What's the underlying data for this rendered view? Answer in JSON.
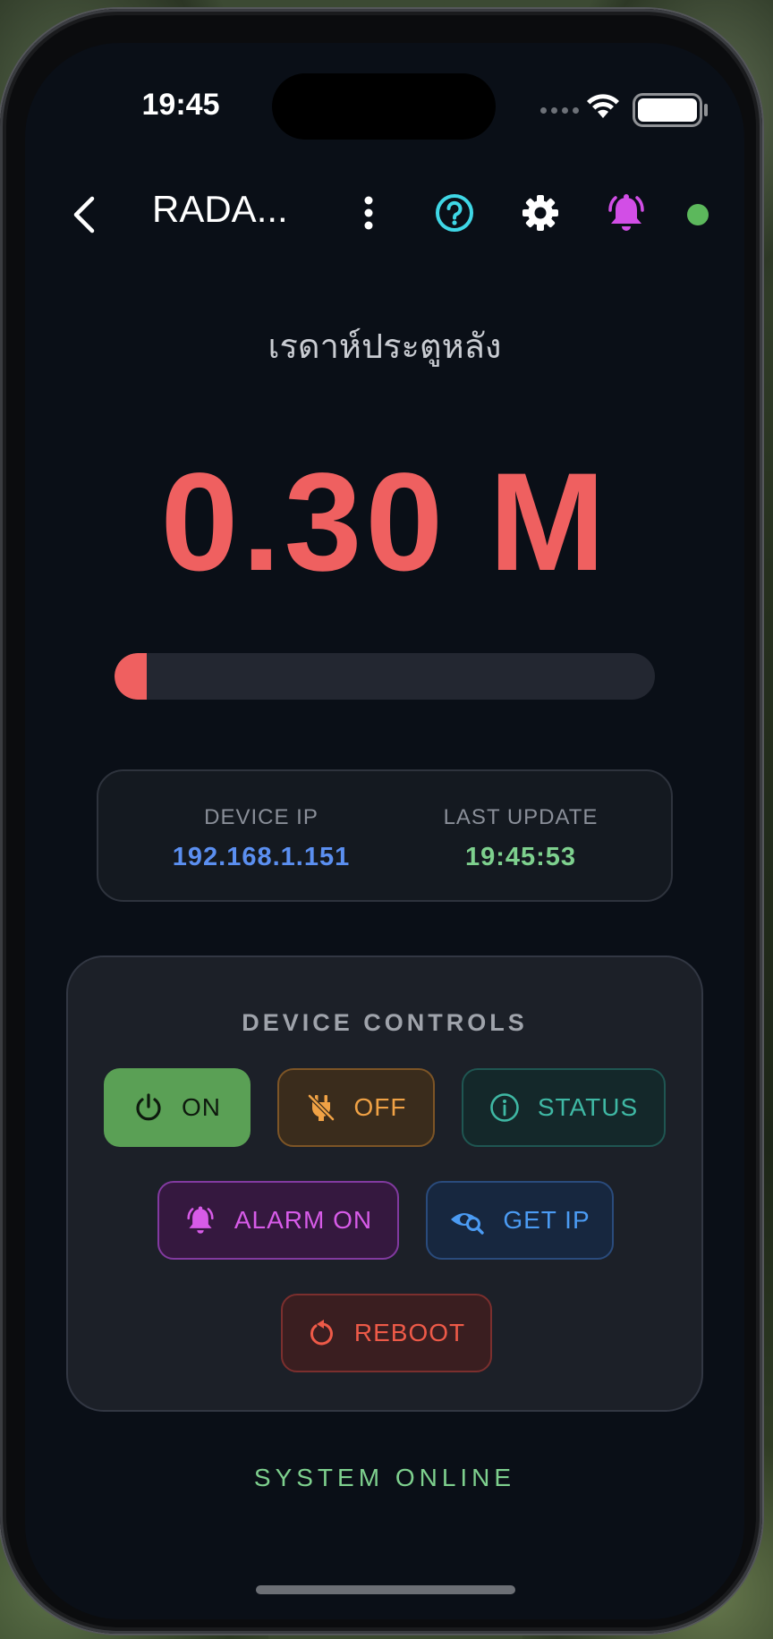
{
  "status_bar": {
    "time": "19:45"
  },
  "header": {
    "title": "RADA...",
    "icons": [
      "chevron-left-icon",
      "more-vertical-icon",
      "help-icon",
      "gear-icon",
      "bell-alert-icon"
    ],
    "connection_status_color": "#5cb85c"
  },
  "device": {
    "name": "เรดาห์ประตูหลัง",
    "distance": "0.30 M",
    "distance_progress": 0.06
  },
  "info": {
    "ip_label": "DEVICE IP",
    "ip_value": "192.168.1.151",
    "update_label": "LAST UPDATE",
    "update_value": "19:45:53"
  },
  "controls": {
    "title": "DEVICE CONTROLS",
    "buttons": [
      {
        "label": "ON",
        "icon": "power-icon",
        "color": "#ffffff"
      },
      {
        "label": "OFF",
        "icon": "plug-off-icon",
        "color": "#f0a245"
      },
      {
        "label": "STATUS",
        "icon": "info-icon",
        "color": "#3fb8a4"
      },
      {
        "label": "ALARM ON",
        "icon": "bell-alert-icon",
        "color": "#d75be8"
      },
      {
        "label": "GET IP",
        "icon": "eye-search-icon",
        "color": "#4b9bf3"
      },
      {
        "label": "REBOOT",
        "icon": "restart-icon",
        "color": "#ee5a48"
      }
    ]
  },
  "footer": {
    "status": "SYSTEM ONLINE"
  },
  "colors": {
    "accent_red": "#ef6060",
    "ip_blue": "#5b8ff0",
    "time_green": "#7ed08e"
  }
}
